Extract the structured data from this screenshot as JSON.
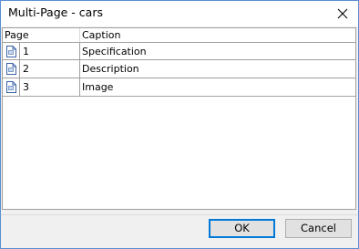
{
  "window": {
    "title": "Multi-Page - cars"
  },
  "grid": {
    "headers": {
      "page": "Page",
      "caption": "Caption"
    },
    "rows": [
      {
        "page": "1",
        "caption": "Specification",
        "icon": "page-icon"
      },
      {
        "page": "2",
        "caption": "Description",
        "icon": "page-icon"
      },
      {
        "page": "3",
        "caption": "Image",
        "icon": "page-icon"
      }
    ]
  },
  "buttons": {
    "ok_label": "OK",
    "cancel_label": "Cancel"
  },
  "colors": {
    "window_border": "#5a8fd3",
    "default_button_border": "#0078d7",
    "grid_line": "#a0a0a0"
  }
}
